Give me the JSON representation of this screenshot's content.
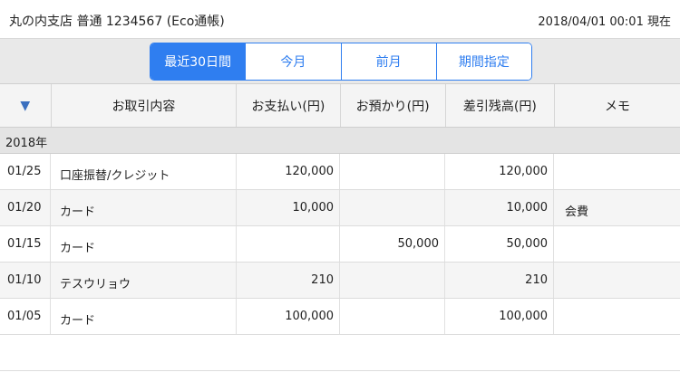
{
  "header": {
    "account": "丸の内支店 普通 1234567 (Eco通帳)",
    "timestamp": "2018/04/01 00:01 現在"
  },
  "period_tabs": [
    {
      "label": "最近30日間",
      "active": true
    },
    {
      "label": "今月",
      "active": false
    },
    {
      "label": "前月",
      "active": false
    },
    {
      "label": "期間指定",
      "active": false
    }
  ],
  "table": {
    "sort_icon": "▼",
    "columns": [
      "お取引内容",
      "お支払い(円)",
      "お預かり(円)",
      "差引残高(円)",
      "メモ"
    ],
    "year_label": "2018年",
    "rows": [
      {
        "date": "01/25",
        "desc": "口座振替/クレジット",
        "payment": "120,000",
        "deposit": "",
        "balance": "120,000",
        "memo": ""
      },
      {
        "date": "01/20",
        "desc": "カード",
        "payment": "10,000",
        "deposit": "",
        "balance": "10,000",
        "memo": "会費"
      },
      {
        "date": "01/15",
        "desc": "カード",
        "payment": "",
        "deposit": "50,000",
        "balance": "50,000",
        "memo": ""
      },
      {
        "date": "01/10",
        "desc": "テスウリョウ",
        "payment": "210",
        "deposit": "",
        "balance": "210",
        "memo": ""
      },
      {
        "date": "01/05",
        "desc": "カード",
        "payment": "100,000",
        "deposit": "",
        "balance": "100,000",
        "memo": ""
      }
    ]
  },
  "colors": {
    "accent": "#2f7ef0",
    "sort_icon": "#3a6fbf"
  }
}
